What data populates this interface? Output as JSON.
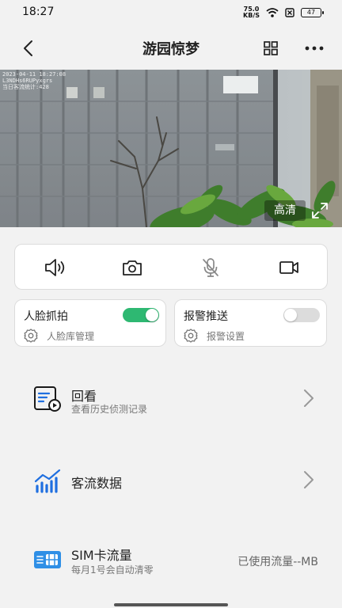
{
  "status_bar": {
    "time": "18:27",
    "net_speed_value": "75.0",
    "net_speed_unit": "KB/S",
    "battery": "47"
  },
  "header": {
    "title": "游园惊梦"
  },
  "video": {
    "osd_line1": "2023-04-11 18:27:08",
    "osd_line2": "L3NDHs6RUPyxgrs",
    "osd_line3": "当日客流统计:428",
    "quality_label": "高清"
  },
  "controls": [
    {
      "icon": "speaker-icon"
    },
    {
      "icon": "camera-icon"
    },
    {
      "icon": "microphone-muted-icon"
    },
    {
      "icon": "video-record-icon"
    }
  ],
  "toggles": {
    "face": {
      "title": "人脸抓拍",
      "sub": "人脸库管理",
      "on": true
    },
    "alarm": {
      "title": "报警推送",
      "sub": "报警设置",
      "on": false
    }
  },
  "list": {
    "playback": {
      "title": "回看",
      "sub": "查看历史侦测记录"
    },
    "traffic": {
      "title": "客流数据"
    },
    "sim": {
      "title": "SIM卡流量",
      "sub": "每月1号会自动清零",
      "value": "已使用流量--MB"
    }
  },
  "colors": {
    "accent_green": "#2eb872",
    "icon_blue": "#1f6fe0",
    "icon_dark": "#222222"
  }
}
